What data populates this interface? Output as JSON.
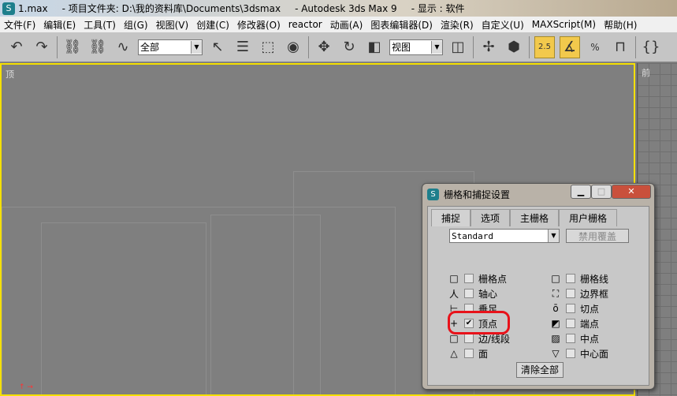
{
  "title": {
    "file": "1.max",
    "project": "- 项目文件夹: D:\\我的资料库\\Documents\\3dsmax",
    "app": "- Autodesk 3ds Max 9",
    "display": "- 显示 : 软件"
  },
  "menu": [
    "文件(F)",
    "编辑(E)",
    "工具(T)",
    "组(G)",
    "视图(V)",
    "创建(C)",
    "修改器(O)",
    "reactor",
    "动画(A)",
    "图表编辑器(D)",
    "渲染(R)",
    "自定义(U)",
    "MAXScript(M)",
    "帮助(H)"
  ],
  "toolbar": {
    "selection_filter": "全部",
    "coord_system": "视图",
    "snap_label": "2.5",
    "percent_label": "%"
  },
  "viewports": {
    "top_label": "顶",
    "front_label": "前"
  },
  "dialog": {
    "title": "栅格和捕捉设置",
    "tabs": [
      "捕捉",
      "选项",
      "主栅格",
      "用户栅格"
    ],
    "preset": "Standard",
    "override_button": "禁用覆盖",
    "left_options": [
      {
        "label": "栅格点",
        "glyph": "□",
        "checked": false
      },
      {
        "label": "轴心",
        "glyph": "人",
        "checked": false
      },
      {
        "label": "垂足",
        "glyph": "⊢",
        "checked": false
      },
      {
        "label": "顶点",
        "glyph": "+",
        "checked": true
      },
      {
        "label": "边/线段",
        "glyph": "□",
        "checked": false
      },
      {
        "label": "面",
        "glyph": "△",
        "checked": false
      }
    ],
    "right_options": [
      {
        "label": "栅格线",
        "glyph": "□",
        "checked": false
      },
      {
        "label": "边界框",
        "glyph": "⛶",
        "checked": false
      },
      {
        "label": "切点",
        "glyph": "ō",
        "checked": false
      },
      {
        "label": "端点",
        "glyph": "◩",
        "checked": false
      },
      {
        "label": "中点",
        "glyph": "▨",
        "checked": false
      },
      {
        "label": "中心面",
        "glyph": "▽",
        "checked": false
      }
    ],
    "clear_button": "清除全部",
    "highlight_color": "#e8121a"
  }
}
